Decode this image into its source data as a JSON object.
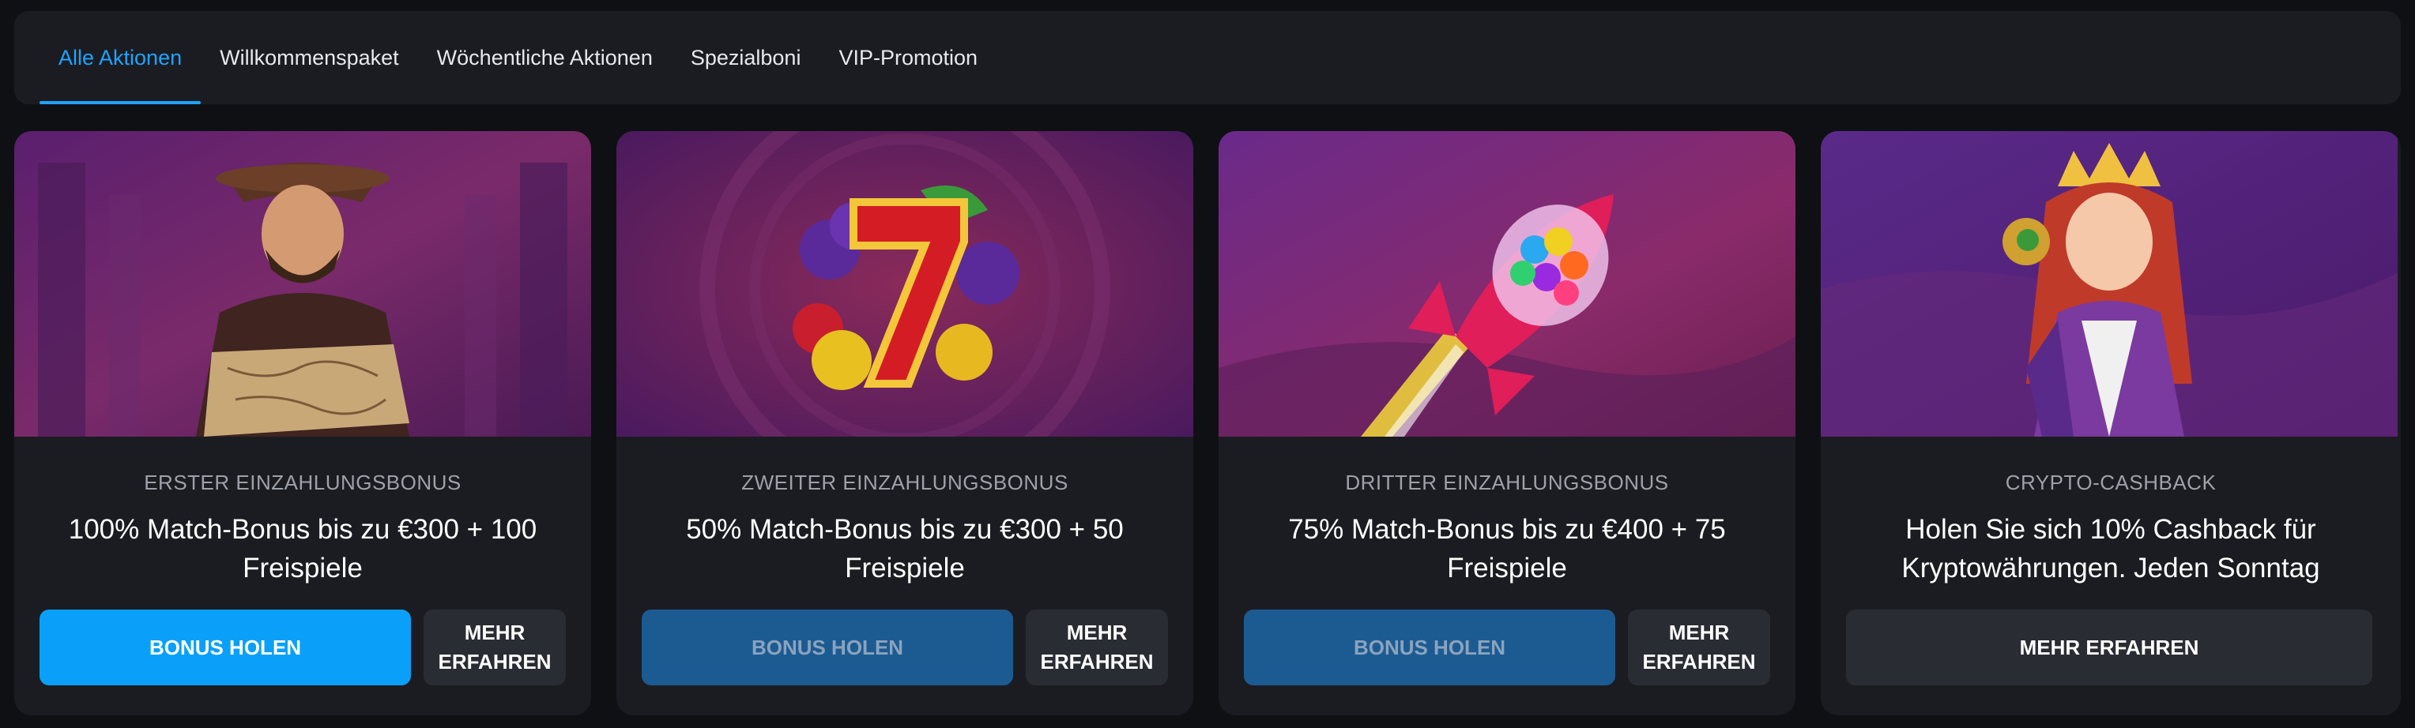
{
  "tabs": [
    {
      "label": "Alle Aktionen",
      "active": true
    },
    {
      "label": "Willkommenspaket",
      "active": false
    },
    {
      "label": "Wöchentliche Aktionen",
      "active": false
    },
    {
      "label": "Spezialboni",
      "active": false
    },
    {
      "label": "VIP-Promotion",
      "active": false
    }
  ],
  "colors": {
    "accent": "#1fa3ff",
    "primary_button": "#0aa0f9",
    "primary_button_dim": "#1c5b92",
    "card_background": "#1b1c21",
    "page_background": "#0f1014"
  },
  "cards": [
    {
      "art": "cowboy-explorer-with-map",
      "subtitle": "ERSTER EINZAHLUNGSBONUS",
      "title": "100% Match-Bonus bis zu €300 + 100 Freispiele",
      "primary_button": "BONUS HOLEN",
      "secondary_button": "MEHR ERFAHREN"
    },
    {
      "art": "lucky-seven-with-fruits",
      "subtitle": "ZWEITER EINZAHLUNGSBONUS",
      "title": "50% Match-Bonus bis zu €300 + 50 Freispiele",
      "primary_button": "BONUS HOLEN",
      "secondary_button": "MEHR ERFAHREN"
    },
    {
      "art": "candy-rocket",
      "subtitle": "DRITTER EINZAHLUNGSBONUS",
      "title": "75% Match-Bonus bis zu €400 + 75 Freispiele",
      "primary_button": "BONUS HOLEN",
      "secondary_button": "MEHR ERFAHREN"
    },
    {
      "art": "crowned-queen-with-treasure",
      "subtitle": "CRYPTO-CASHBACK",
      "title": "Holen Sie sich 10% Cashback für Kryptowährungen. Jeden Sonntag",
      "secondary_button": "MEHR ERFAHREN"
    }
  ]
}
